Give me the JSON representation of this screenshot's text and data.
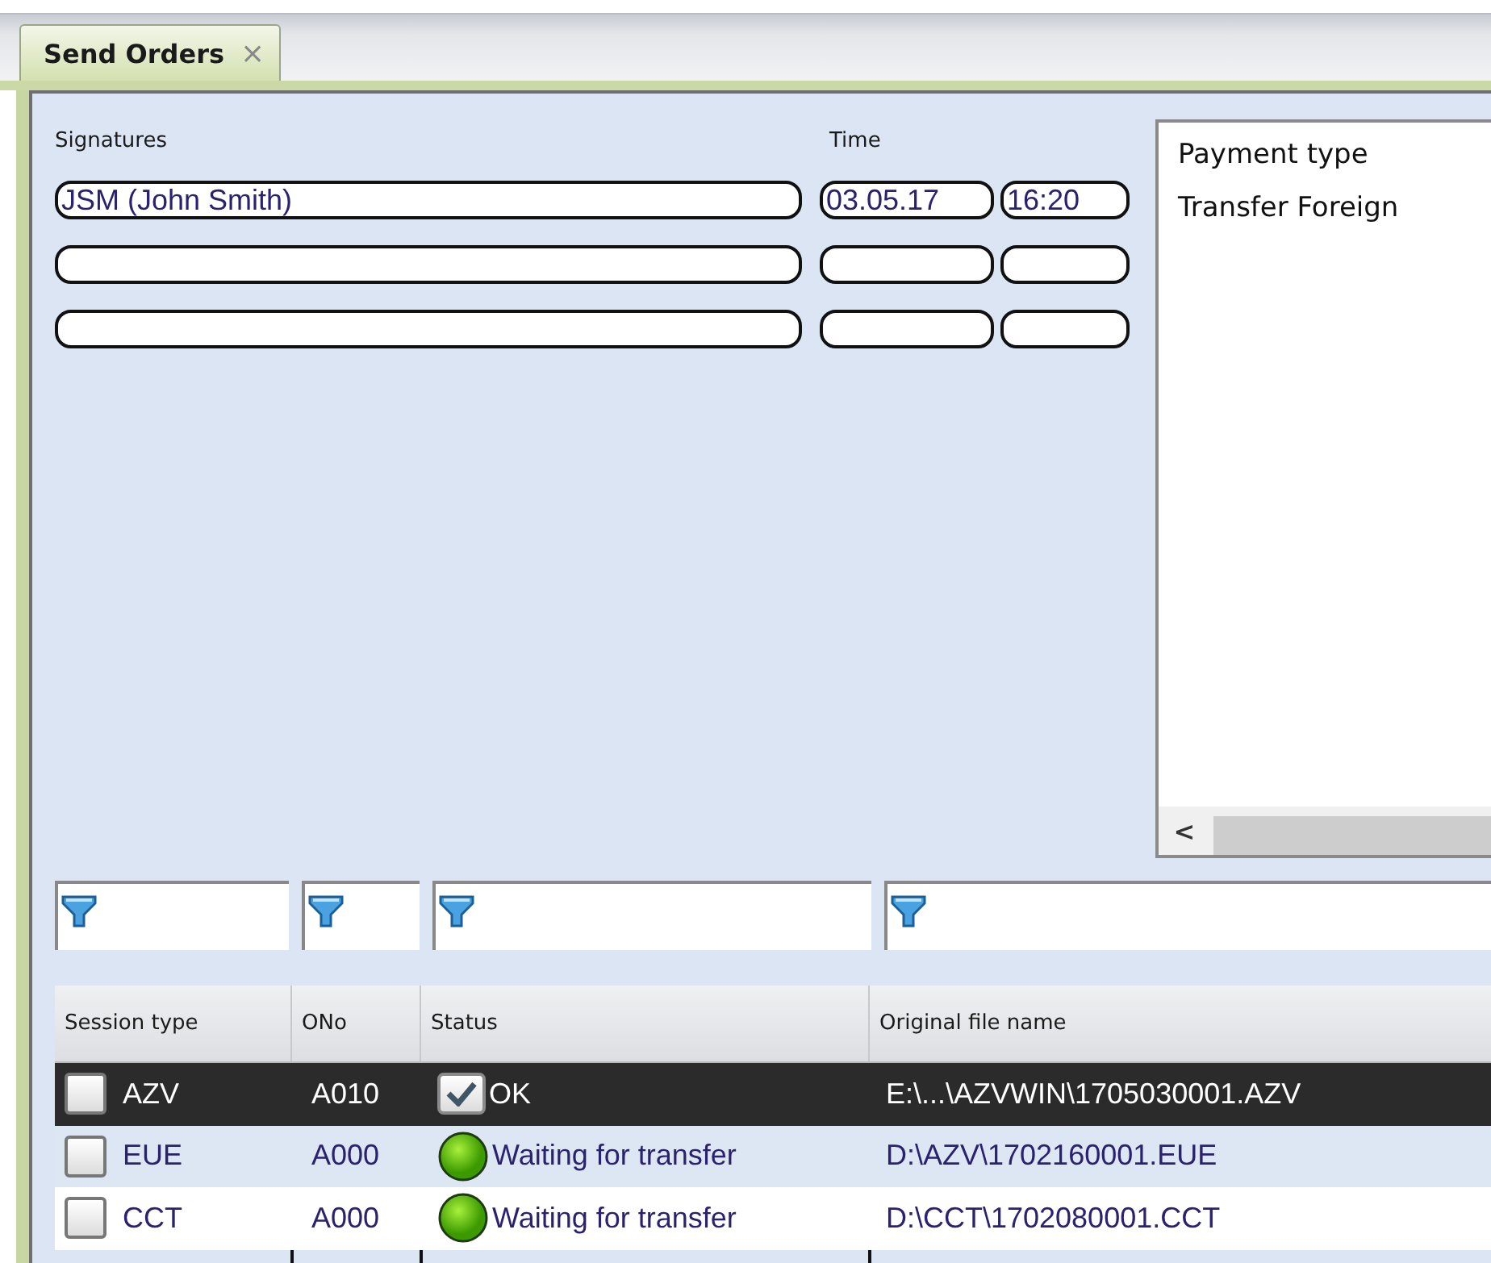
{
  "tabs": [
    {
      "label": "Send Orders",
      "close": "×",
      "selected": true
    }
  ],
  "signatures": {
    "label": "Signatures",
    "time_label": "Time",
    "rows": [
      {
        "name": "JSM (John Smith)",
        "date": "03.05.17",
        "time": "16:20"
      },
      {},
      {}
    ]
  },
  "payment_list": {
    "header": "Payment type",
    "items": [
      "Transfer Foreign"
    ],
    "scroll_arrow": "<"
  },
  "table": {
    "columns": [
      "Session type",
      "ONo",
      "Status",
      "Original file name"
    ],
    "rows": [
      {
        "selected": true,
        "checked": false,
        "session_type": "AZV",
        "ono": "A010",
        "status": {
          "kind": "ok",
          "text": "OK"
        },
        "file": "E:\\...\\AZVWIN\\1705030001.AZV"
      },
      {
        "selected": false,
        "checked": false,
        "session_type": "EUE",
        "ono": "A000",
        "status": {
          "kind": "waiting",
          "text": "Waiting for transfer"
        },
        "file": "D:\\AZV\\1702160001.EUE"
      },
      {
        "selected": false,
        "checked": false,
        "session_type": "CCT",
        "ono": "A000",
        "status": {
          "kind": "waiting",
          "text": "Waiting for transfer"
        },
        "file": "D:\\CCT\\1702080001.CCT"
      }
    ]
  }
}
